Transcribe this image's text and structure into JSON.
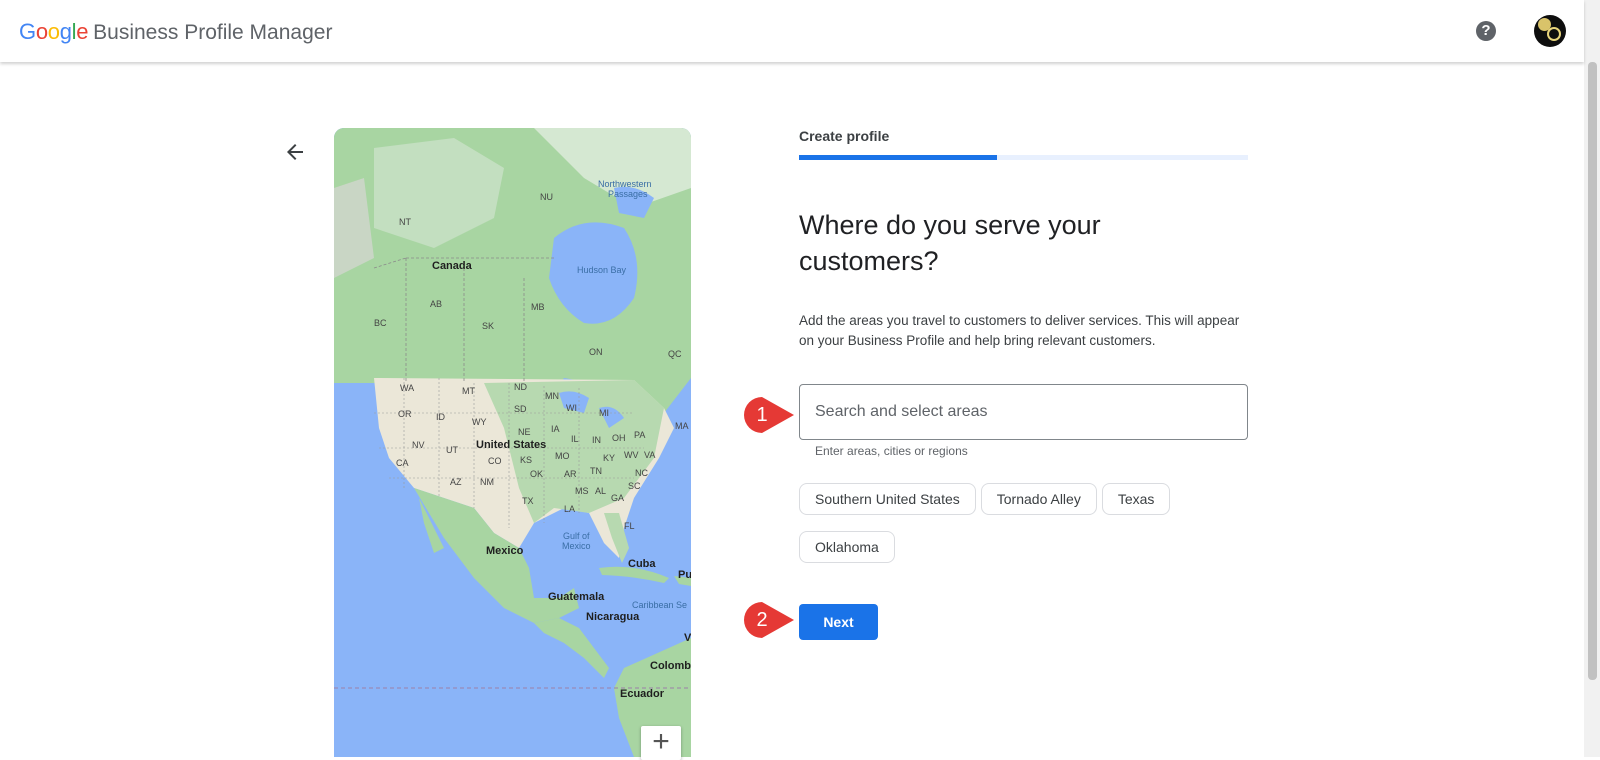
{
  "header": {
    "google_word": [
      "G",
      "o",
      "o",
      "g",
      "l",
      "e"
    ],
    "google_colors": [
      "#4285F4",
      "#EA4335",
      "#FBBC05",
      "#4285F4",
      "#34A853",
      "#EA4335"
    ],
    "product_name": "Business Profile Manager",
    "help_icon_glyph": "?",
    "avatar_icon": "avatar-icon"
  },
  "nav": {
    "back_icon": "arrow-back-icon"
  },
  "map": {
    "labels": {
      "canada": "Canada",
      "hudson_bay": "Hudson Bay",
      "northwestern_passages_1": "Northwestern",
      "northwestern_passages_2": "Passages",
      "nu": "NU",
      "nt": "NT",
      "ab": "AB",
      "bc": "BC",
      "sk": "SK",
      "mb": "MB",
      "on": "ON",
      "qc": "QC",
      "wa": "WA",
      "mt": "MT",
      "nd": "ND",
      "mn": "MN",
      "or": "OR",
      "id": "ID",
      "sd": "SD",
      "wi": "WI",
      "mi": "MI",
      "wy": "WY",
      "ne": "NE",
      "ia": "IA",
      "nv": "NV",
      "ut": "UT",
      "il": "IL",
      "in": "IN",
      "oh": "OH",
      "pa": "PA",
      "ca": "CA",
      "co": "CO",
      "ks": "KS",
      "mo": "MO",
      "ky": "KY",
      "wv": "WV",
      "va": "VA",
      "az": "AZ",
      "nm": "NM",
      "ok": "OK",
      "ar": "AR",
      "tn": "TN",
      "nc": "NC",
      "sc": "SC",
      "ms": "MS",
      "al": "AL",
      "ga": "GA",
      "tx": "TX",
      "la": "LA",
      "fl": "FL",
      "ma": "MA",
      "united_states": "United States",
      "gulf_1": "Gulf of",
      "gulf_2": "Mexico",
      "mexico": "Mexico",
      "cuba": "Cuba",
      "pu": "Pu",
      "guatemala": "Guatemala",
      "nicaragua": "Nicaragua",
      "caribbean": "Caribbean Se",
      "colombia": "Colomb",
      "ecuador": "Ecuador",
      "v": "V"
    },
    "zoom_in_glyph": "+"
  },
  "form": {
    "step_label": "Create profile",
    "progress_fraction": 0.44,
    "heading": "Where do you serve your customers?",
    "description": "Add the areas you travel to customers to deliver services. This will appear on your Business Profile and help bring relevant customers.",
    "search_placeholder": "Search and select areas",
    "search_value": "",
    "helper_text": "Enter areas, cities or regions",
    "suggestions": [
      "Southern United States",
      "Tornado Alley",
      "Texas",
      "Oklahoma"
    ],
    "next_label": "Next"
  },
  "annotations": {
    "callout_1": "1",
    "callout_2": "2",
    "callout_color": "#e53935"
  }
}
